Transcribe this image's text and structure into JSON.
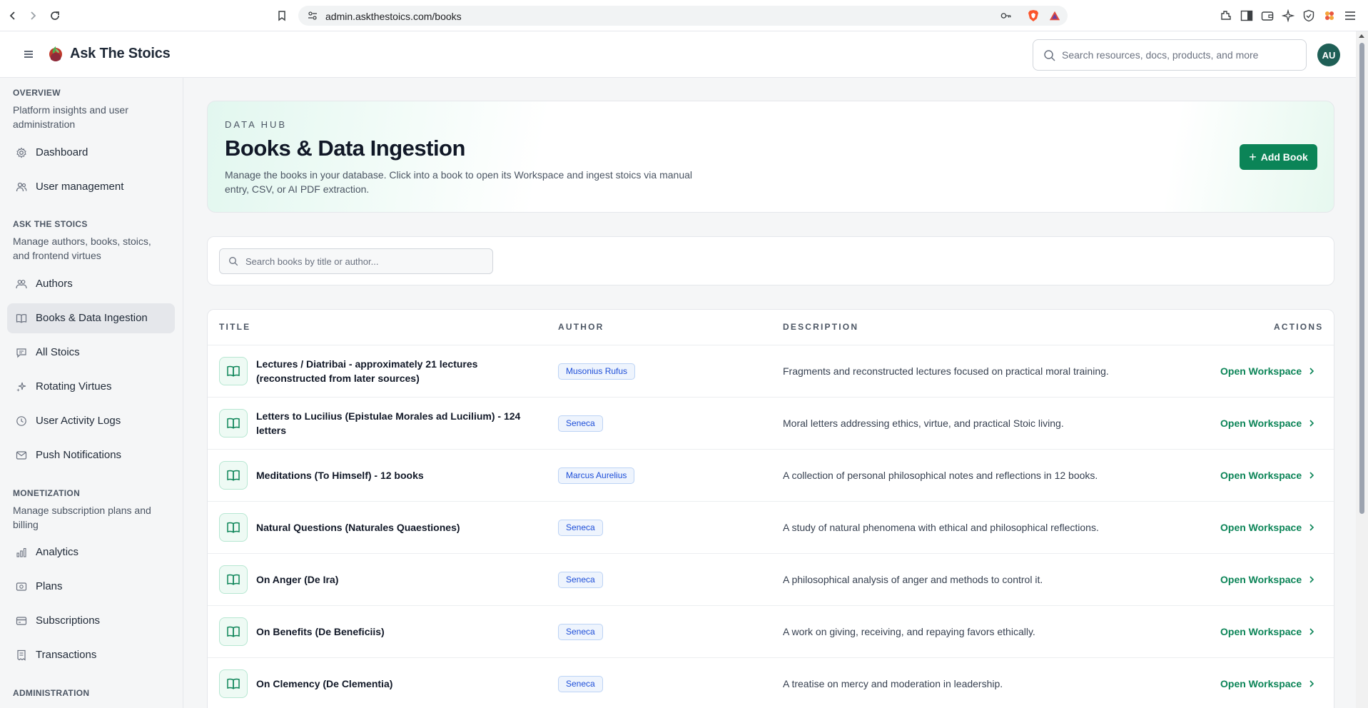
{
  "browser": {
    "url": "admin.askthestoics.com/books"
  },
  "header": {
    "brand": "Ask The Stoics",
    "search_placeholder": "Search resources, docs, products, and more",
    "avatar_initials": "AU"
  },
  "sidebar": {
    "sections": [
      {
        "title": "OVERVIEW",
        "description": "Platform insights and user administration",
        "items": [
          {
            "label": "Dashboard",
            "icon": "gear-icon"
          },
          {
            "label": "User management",
            "icon": "users-icon"
          }
        ]
      },
      {
        "title": "ASK THE STOICS",
        "description": "Manage authors, books, stoics, and frontend virtues",
        "items": [
          {
            "label": "Authors",
            "icon": "authors-icon"
          },
          {
            "label": "Books & Data Ingestion",
            "icon": "book-icon",
            "active": true
          },
          {
            "label": "All Stoics",
            "icon": "chat-icon"
          },
          {
            "label": "Rotating Virtues",
            "icon": "sparkle-icon"
          },
          {
            "label": "User Activity Logs",
            "icon": "clock-icon"
          },
          {
            "label": "Push Notifications",
            "icon": "mail-icon"
          }
        ]
      },
      {
        "title": "MONETIZATION",
        "description": "Manage subscription plans and billing",
        "items": [
          {
            "label": "Analytics",
            "icon": "bar-chart-icon"
          },
          {
            "label": "Plans",
            "icon": "plans-icon"
          },
          {
            "label": "Subscriptions",
            "icon": "card-icon"
          },
          {
            "label": "Transactions",
            "icon": "receipt-icon"
          }
        ]
      },
      {
        "title": "ADMINISTRATION",
        "description": "",
        "items": []
      }
    ]
  },
  "hero": {
    "eyebrow": "DATA HUB",
    "title": "Books & Data Ingestion",
    "description": "Manage the books in your database. Click into a book to open its Workspace and ingest stoics via manual entry, CSV, or AI PDF extraction.",
    "add_button": "Add Book"
  },
  "book_search": {
    "placeholder": "Search books by title or author..."
  },
  "table": {
    "columns": [
      "TITLE",
      "AUTHOR",
      "DESCRIPTION",
      "ACTIONS"
    ],
    "action_label": "Open Workspace",
    "rows": [
      {
        "title": "Lectures / Diatribai - approximately 21 lectures (reconstructed from later sources)",
        "author": "Musonius Rufus",
        "description": "Fragments and reconstructed lectures focused on practical moral training."
      },
      {
        "title": "Letters to Lucilius (Epistulae Morales ad Lucilium) - 124 letters",
        "author": "Seneca",
        "description": "Moral letters addressing ethics, virtue, and practical Stoic living."
      },
      {
        "title": "Meditations (To Himself) - 12 books",
        "author": "Marcus Aurelius",
        "description": "A collection of personal philosophical notes and reflections in 12 books."
      },
      {
        "title": "Natural Questions (Naturales Quaestiones)",
        "author": "Seneca",
        "description": "A study of natural phenomena with ethical and philosophical reflections."
      },
      {
        "title": "On Anger (De Ira)",
        "author": "Seneca",
        "description": "A philosophical analysis of anger and methods to control it."
      },
      {
        "title": "On Benefits (De Beneficiis)",
        "author": "Seneca",
        "description": "A work on giving, receiving, and repaying favors ethically."
      },
      {
        "title": "On Clemency (De Clementia)",
        "author": "Seneca",
        "description": "A treatise on mercy and moderation in leadership."
      }
    ]
  },
  "colors": {
    "accent_green": "#0b8457",
    "badge_blue": "#1d4ed8",
    "avatar_bg": "#1f5f56"
  }
}
